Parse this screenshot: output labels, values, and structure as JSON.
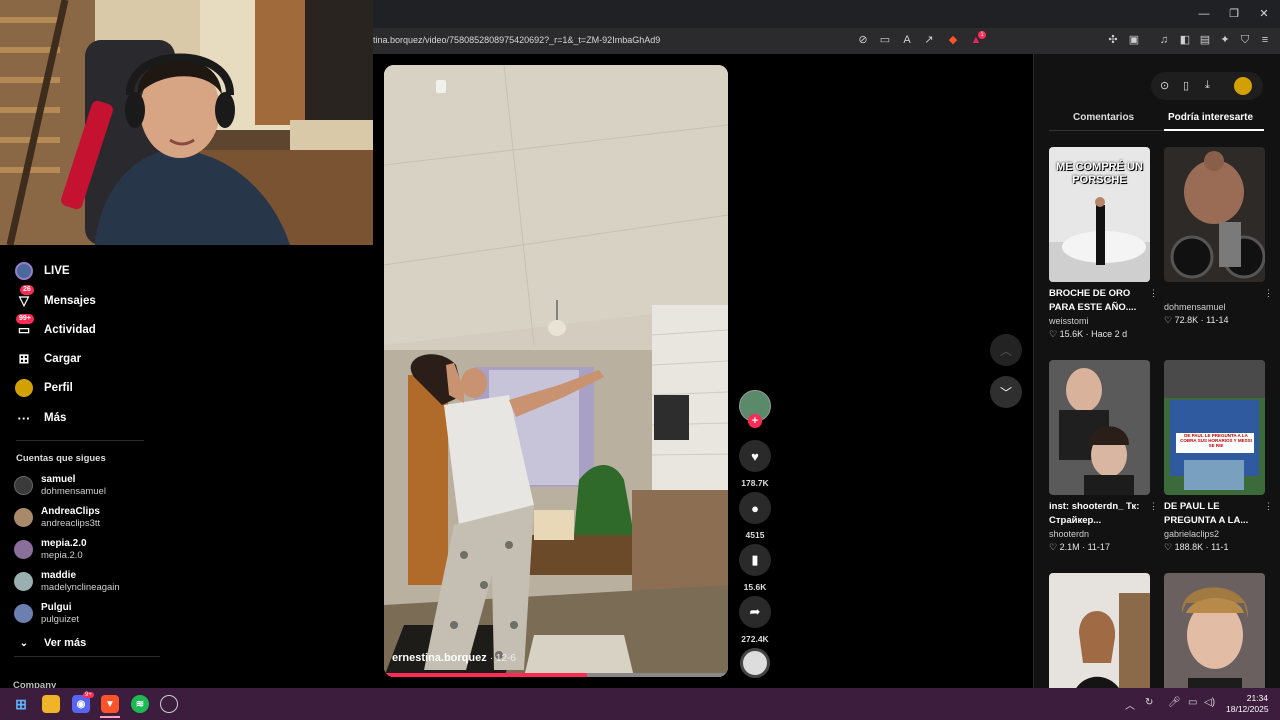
{
  "browser": {
    "url": "tina.borquez/video/7580852808975420692?_r=1&_t=ZM-92ImbaGhAd9",
    "ext_badge_1": "9",
    "ext_badge_2": "1"
  },
  "sidebar": {
    "items": [
      {
        "label": "LIVE",
        "icon": "live-icon",
        "badge": ""
      },
      {
        "label": "Mensajes",
        "icon": "paper-plane-icon",
        "badge": "26"
      },
      {
        "label": "Actividad",
        "icon": "inbox-icon",
        "badge": "99+"
      },
      {
        "label": "Cargar",
        "icon": "plus-square-icon",
        "badge": ""
      },
      {
        "label": "Perfil",
        "icon": "profile-icon",
        "badge": ""
      },
      {
        "label": "Más",
        "icon": "more-icon",
        "badge": ""
      }
    ],
    "following_title": "Cuentas que sigues",
    "following": [
      {
        "name": "samuel",
        "handle": "dohmensamuel",
        "color": "#3a3a3a"
      },
      {
        "name": "AndreaClips",
        "handle": "andreaclips3tt",
        "color": "#a88a6a"
      },
      {
        "name": "mepia.2.0",
        "handle": "mepia.2.0",
        "color": "#8a6f9a"
      },
      {
        "name": "maddie",
        "handle": "madelynclineagain",
        "color": "#9ab0b0"
      },
      {
        "name": "Pulgui",
        "handle": "pulguizet",
        "color": "#6d7fb0"
      }
    ],
    "see_more": "Ver más",
    "company": "Company"
  },
  "video": {
    "author": "ernestina.borquez",
    "date": "· 12-6",
    "progress": 0.59
  },
  "actions": {
    "likes": "178.7K",
    "comments": "4515",
    "saves": "15.6K",
    "shares": "272.4K"
  },
  "right_panel": {
    "tabs": [
      "Comentarios",
      "Podría interesarte"
    ],
    "cards": [
      {
        "title": "BROCHE DE ORO PARA ESTE AÑO....",
        "overlay": "ME COMPRÉ UN PORSCHE",
        "user": "weisstomi",
        "likes": "15.6K",
        "date": "Hace 2 d"
      },
      {
        "title": "",
        "overlay": "",
        "user": "dohmensamuel",
        "likes": "72.8K",
        "date": "11-14"
      },
      {
        "title": "inst: shooterdn_ Тк: Страйкер...",
        "overlay": "",
        "user": "shooterdn",
        "likes": "2.1M",
        "date": "11-17"
      },
      {
        "title": "DE PAUL LE PREGUNTA A LA...",
        "overlay": "DE PAUL LE PREGUNTA A LA COBRA SUS HORARIOS Y MESSI SE RIE",
        "user": "gabrielaclips2",
        "likes": "188.8K",
        "date": "11-1"
      },
      {
        "title": "",
        "overlay": "",
        "user": "",
        "likes": "",
        "date": ""
      },
      {
        "title": "",
        "overlay": "",
        "user": "",
        "likes": "",
        "date": ""
      }
    ]
  },
  "taskbar": {
    "time": "21:34",
    "date": "18/12/2025",
    "discord_badge": "9+"
  },
  "colors": {
    "accent": "#fe2c55",
    "taskbar": "#3c1d3e"
  }
}
